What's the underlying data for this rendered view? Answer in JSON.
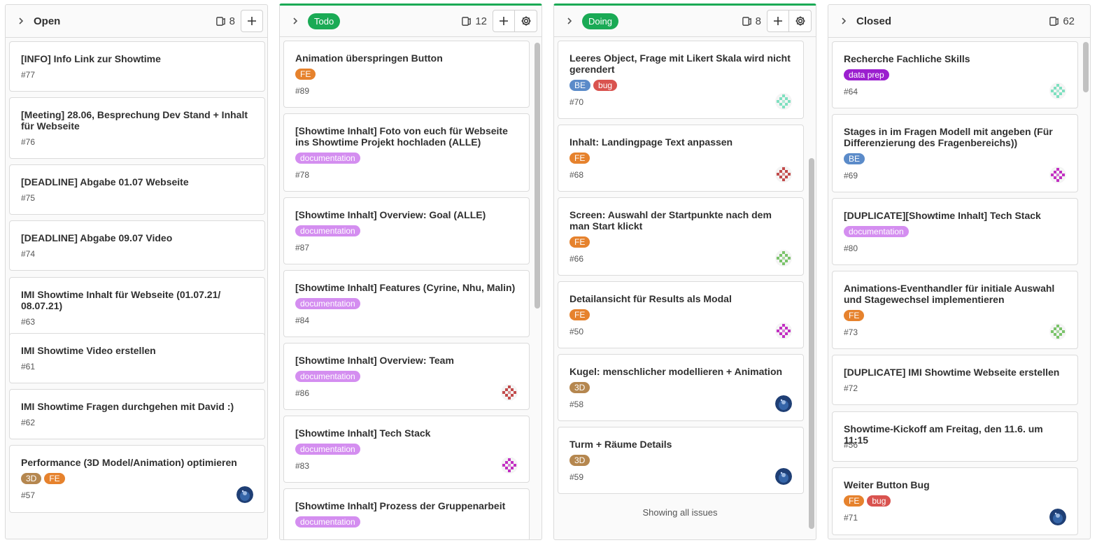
{
  "colors": {
    "FE": "#e6822d",
    "BE": "#5b8bc9",
    "bug": "#d9534f",
    "3D": "#b5874f",
    "documentation": "#d48ef0",
    "data prep": "#9b1fcf",
    "status_green": "#1aaa55"
  },
  "columns": [
    {
      "title": "Open",
      "pill": false,
      "count": "8",
      "show_settings": false,
      "cards": [
        {
          "title": "[INFO] Info Link zur Showtime",
          "labels": [],
          "ref": "#77",
          "avatar": null
        },
        {
          "title": "[Meeting] 28.06, Besprechung Dev Stand + Inhalt für Webseite",
          "labels": [],
          "ref": "#76",
          "avatar": null
        },
        {
          "title": "[DEADLINE] Abgabe 01.07 Webseite",
          "labels": [],
          "ref": "#75",
          "avatar": null
        },
        {
          "title": "[DEADLINE] Abgabe 09.07 Video",
          "labels": [],
          "ref": "#74",
          "avatar": null
        },
        {
          "title": "IMI Showtime Inhalt für Webseite (01.07.21/ 08.07.21)",
          "labels": [],
          "ref": "#63",
          "avatar": null
        },
        {
          "title": "IMI Showtime Video erstellen",
          "labels": [],
          "ref": "#61",
          "avatar": null
        },
        {
          "title": "IMI Showtime Fragen durchgehen mit David :)",
          "labels": [],
          "ref": "#62",
          "avatar": null
        },
        {
          "title": "Performance (3D Model/Animation) optimieren",
          "labels": [
            "3D",
            "FE"
          ],
          "ref": "#57",
          "avatar": "photo"
        }
      ]
    },
    {
      "title": "Todo",
      "pill": true,
      "count": "12",
      "show_settings": true,
      "cards": [
        {
          "title": "Animation überspringen Button",
          "labels": [
            "FE"
          ],
          "ref": "#89",
          "avatar": null
        },
        {
          "title": "[Showtime Inhalt] Foto von euch für Webseite ins Showtime Projekt hochladen (ALLE)",
          "labels": [
            "documentation"
          ],
          "ref": "#78",
          "avatar": null
        },
        {
          "title": "[Showtime Inhalt] Overview: Goal (ALLE)",
          "labels": [
            "documentation"
          ],
          "ref": "#87",
          "avatar": null
        },
        {
          "title": "[Showtime Inhalt] Features (Cyrine, Nhu, Malin)",
          "labels": [
            "documentation"
          ],
          "ref": "#84",
          "avatar": null
        },
        {
          "title": "[Showtime Inhalt] Overview: Team",
          "labels": [
            "documentation"
          ],
          "ref": "#86",
          "avatar": "red"
        },
        {
          "title": "[Showtime Inhalt] Tech Stack",
          "labels": [
            "documentation"
          ],
          "ref": "#83",
          "avatar": "magenta"
        },
        {
          "title": "[Showtime Inhalt] Prozess der Gruppenarbeit",
          "labels": [
            "documentation"
          ],
          "ref": "",
          "avatar": null
        }
      ]
    },
    {
      "title": "Doing",
      "pill": true,
      "count": "8",
      "show_settings": true,
      "footer": "Showing all issues",
      "cards": [
        {
          "title": "Leeres Object, Frage mit Likert Skala wird nicht gerendert",
          "labels": [
            "BE",
            "bug"
          ],
          "ref": "#70",
          "avatar": "mint"
        },
        {
          "title": "Inhalt: Landingpage Text anpassen",
          "labels": [
            "FE"
          ],
          "ref": "#68",
          "avatar": "red"
        },
        {
          "title": "Screen: Auswahl der Startpunkte nach dem man Start klickt",
          "labels": [
            "FE"
          ],
          "ref": "#66",
          "avatar": "green"
        },
        {
          "title": "Detailansicht für Results als Modal",
          "labels": [
            "FE"
          ],
          "ref": "#50",
          "avatar": "magenta"
        },
        {
          "title": "Kugel: menschlicher modellieren + Animation",
          "labels": [
            "3D"
          ],
          "ref": "#58",
          "avatar": "photo"
        },
        {
          "title": "Turm + Räume Details",
          "labels": [
            "3D"
          ],
          "ref": "#59",
          "avatar": "photo"
        }
      ]
    },
    {
      "title": "Closed",
      "pill": false,
      "count": "62",
      "show_settings": false,
      "show_add": false,
      "cards": [
        {
          "title": "Recherche Fachliche Skills",
          "labels": [
            "data prep"
          ],
          "ref": "#64",
          "avatar": "mint"
        },
        {
          "title": "Stages in im Fragen Modell mit angeben (Für Differenzierung des Fragenbereichs))",
          "labels": [
            "BE"
          ],
          "ref": "#69",
          "avatar": "magenta"
        },
        {
          "title": "[DUPLICATE][Showtime Inhalt] Tech Stack",
          "labels": [
            "documentation"
          ],
          "ref": "#80",
          "avatar": null
        },
        {
          "title": "Animations-Eventhandler für initiale Auswahl und Stagewechsel implementieren",
          "labels": [
            "FE"
          ],
          "ref": "#73",
          "avatar": "green"
        },
        {
          "title": "[DUPLICATE] IMI Showtime Webseite erstellen",
          "labels": [],
          "ref": "#72",
          "avatar": null
        },
        {
          "title": "Showtime-Kickoff am Freitag, den 11.6. um 11:15",
          "labels": [],
          "ref": "#56",
          "avatar": null
        },
        {
          "title": "Weiter Button Bug",
          "labels": [
            "FE",
            "bug"
          ],
          "ref": "#71",
          "avatar": "photo"
        }
      ]
    }
  ]
}
